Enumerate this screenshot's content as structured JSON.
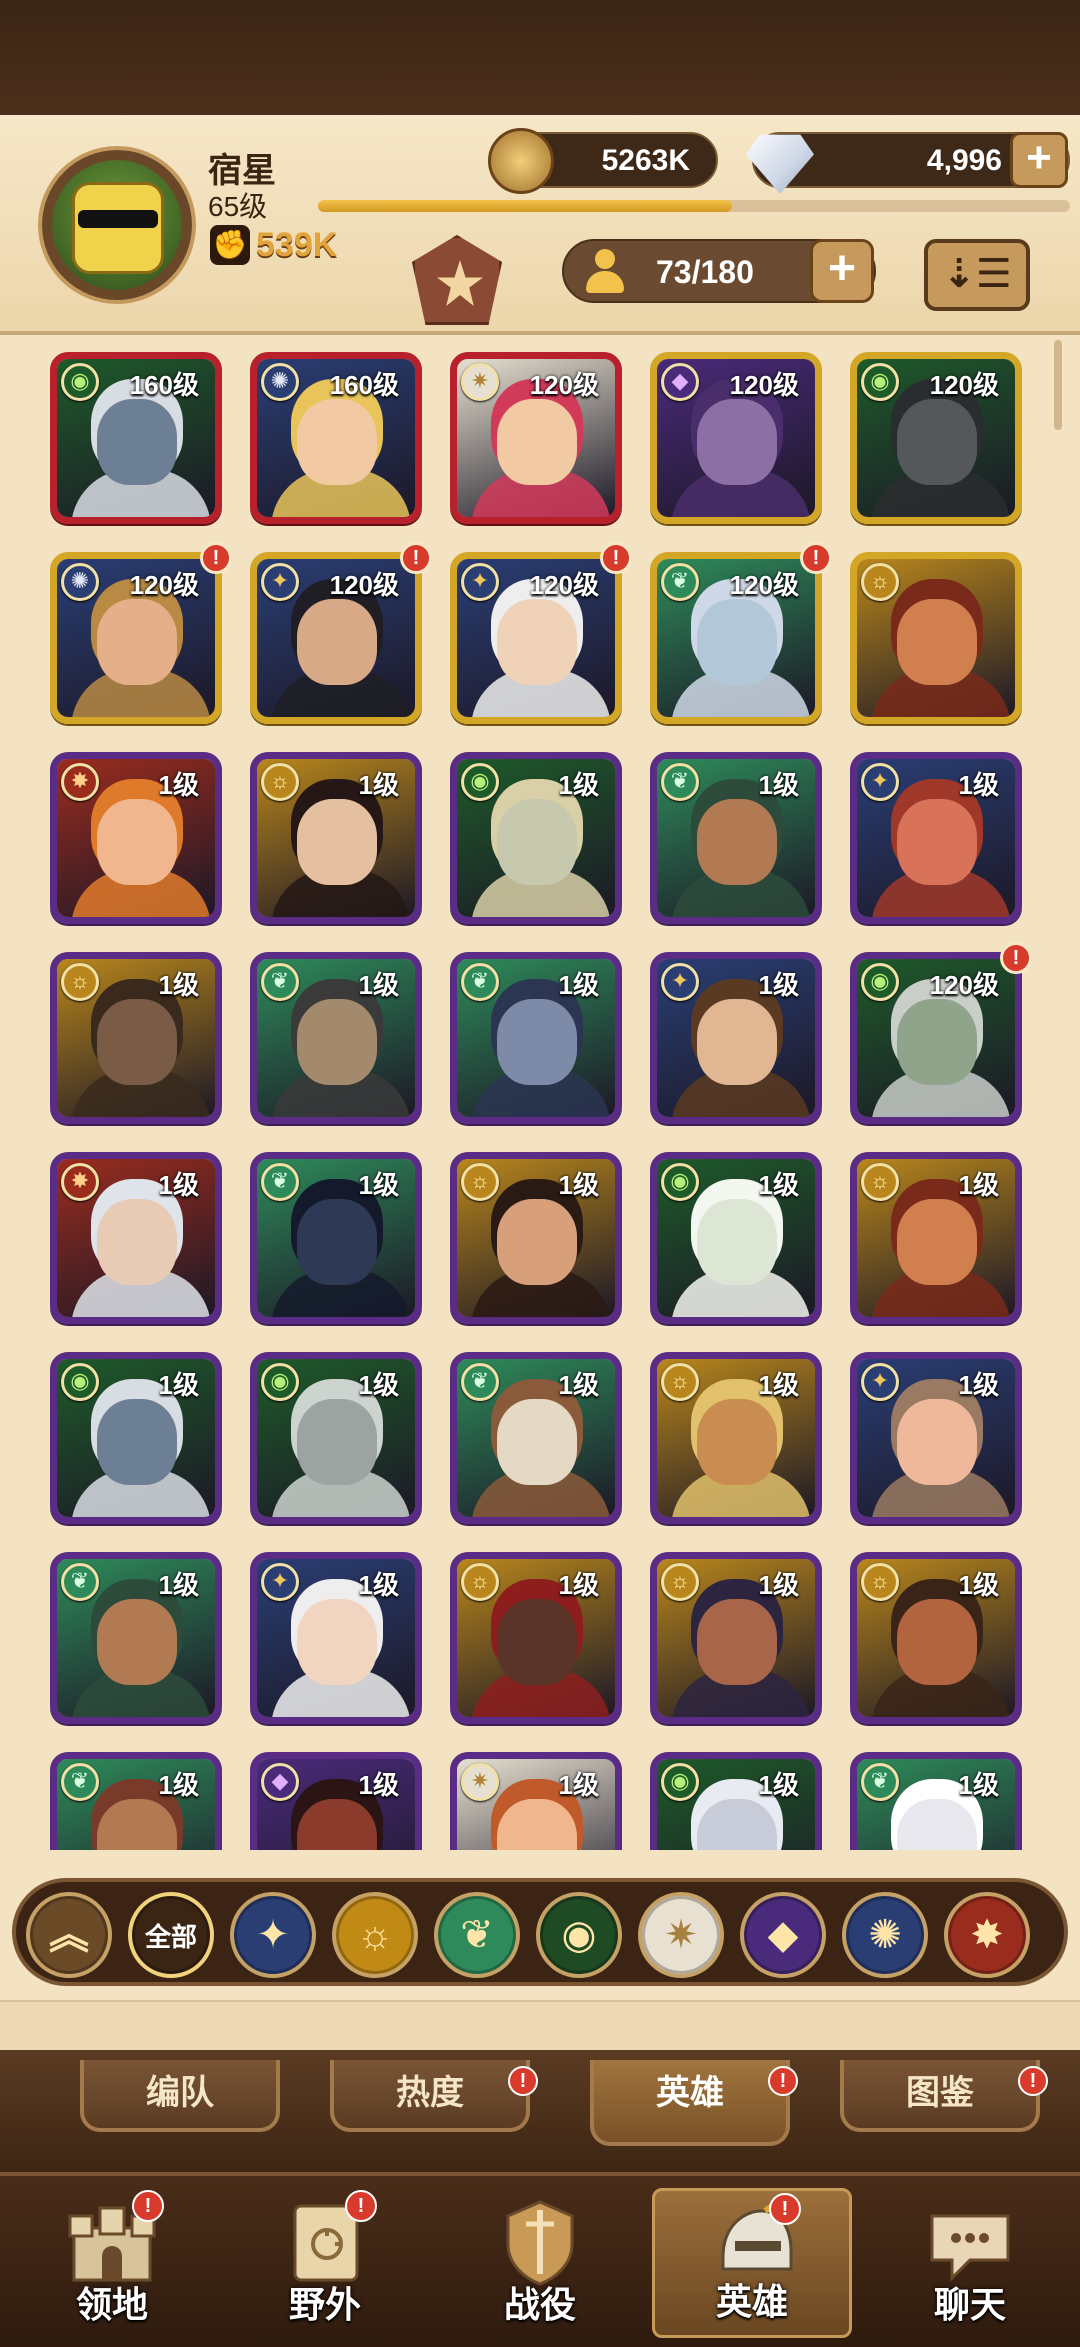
{
  "header": {
    "player_name": "宿星",
    "player_level": "65级",
    "xp_progress": 0.55,
    "power": "539K",
    "gold": "5263K",
    "gems": "4,996",
    "roster": "73/180"
  },
  "colors": {
    "frame_purple": "#5b2c86",
    "frame_gold": "#d4a626",
    "frame_red": "#b8202c",
    "alert_red": "#d83a2c"
  },
  "heroes": [
    {
      "level": "160级",
      "frame": "red",
      "faction": "forest",
      "skin": "#6d7f95",
      "hair": "#d8dde4",
      "alert": false
    },
    {
      "level": "160级",
      "frame": "red",
      "faction": "ring",
      "skin": "#f1c9a3",
      "hair": "#e8c45a",
      "alert": false
    },
    {
      "level": "120级",
      "frame": "red",
      "faction": "light",
      "skin": "#f1c9a3",
      "hair": "#d23a5a",
      "alert": false
    },
    {
      "level": "120级",
      "frame": "gold",
      "faction": "dark",
      "skin": "#8b6fa5",
      "hair": "#4a2e6b",
      "alert": false
    },
    {
      "level": "120级",
      "frame": "gold",
      "faction": "forest",
      "skin": "#55585a",
      "hair": "#2a2d2f",
      "alert": false
    },
    {
      "level": "120级",
      "frame": "gold",
      "faction": "ring",
      "skin": "#e5b089",
      "hair": "#b98a44",
      "alert": true
    },
    {
      "level": "120级",
      "frame": "gold",
      "faction": "star",
      "skin": "#d8a987",
      "hair": "#1e1e24",
      "alert": true
    },
    {
      "level": "120级",
      "frame": "gold",
      "faction": "star",
      "skin": "#efd2b7",
      "hair": "#eeeeee",
      "alert": true
    },
    {
      "level": "120级",
      "frame": "gold",
      "faction": "leaf",
      "skin": "#b2c8d8",
      "hair": "#cfd8e6",
      "alert": true
    },
    {
      "level": "",
      "frame": "gold",
      "faction": "sun",
      "skin": "#d27f4f",
      "hair": "#7a2a1a",
      "alert": false
    },
    {
      "level": "1级",
      "frame": "purple",
      "faction": "fire",
      "skin": "#f0b78e",
      "hair": "#e07a2b",
      "alert": false
    },
    {
      "level": "1级",
      "frame": "purple",
      "faction": "sun",
      "skin": "#e4c0a0",
      "hair": "#241715",
      "alert": false
    },
    {
      "level": "1级",
      "frame": "purple",
      "faction": "forest",
      "skin": "#c7c9ae",
      "hair": "#d9d0a8",
      "alert": false
    },
    {
      "level": "1级",
      "frame": "purple",
      "faction": "leaf",
      "skin": "#b27a52",
      "hair": "#2d4b3b",
      "alert": false
    },
    {
      "level": "1级",
      "frame": "purple",
      "faction": "star",
      "skin": "#d8735a",
      "hair": "#a0382a",
      "alert": false
    },
    {
      "level": "1级",
      "frame": "purple",
      "faction": "sun",
      "skin": "#7a5b45",
      "hair": "#3a2a1e",
      "alert": false
    },
    {
      "level": "1级",
      "frame": "purple",
      "faction": "leaf",
      "skin": "#a38a6c",
      "hair": "#3a3a3a",
      "alert": false
    },
    {
      "level": "1级",
      "frame": "purple",
      "faction": "leaf",
      "skin": "#7d8aa8",
      "hair": "#2c3552",
      "alert": false
    },
    {
      "level": "1级",
      "frame": "purple",
      "faction": "star",
      "skin": "#e1b693",
      "hair": "#5a3a22",
      "alert": false
    },
    {
      "level": "120级",
      "frame": "purple",
      "faction": "forest",
      "skin": "#8fa48a",
      "hair": "#c9cec9",
      "alert": true
    },
    {
      "level": "1级",
      "frame": "purple",
      "faction": "fire",
      "skin": "#e8cbb4",
      "hair": "#dfe3ea",
      "alert": false
    },
    {
      "level": "1级",
      "frame": "purple",
      "faction": "leaf",
      "skin": "#2e3a55",
      "hair": "#141a2b",
      "alert": false
    },
    {
      "level": "1级",
      "frame": "purple",
      "faction": "sun",
      "skin": "#d8a07a",
      "hair": "#2a1a14",
      "alert": false
    },
    {
      "level": "1级",
      "frame": "purple",
      "faction": "forest",
      "skin": "#dde6d4",
      "hair": "#f4f6f0",
      "alert": false
    },
    {
      "level": "1级",
      "frame": "purple",
      "faction": "sun",
      "skin": "#d27f4f",
      "hair": "#7a2a1a",
      "alert": false
    },
    {
      "level": "1级",
      "frame": "purple",
      "faction": "forest",
      "skin": "#6d7f95",
      "hair": "#d8dde4",
      "alert": false
    },
    {
      "level": "1级",
      "frame": "purple",
      "faction": "forest",
      "skin": "#9ca3a1",
      "hair": "#cdd3cf",
      "alert": false
    },
    {
      "level": "1级",
      "frame": "purple",
      "faction": "leaf",
      "skin": "#e5d8c4",
      "hair": "#8a5a3a",
      "alert": false
    },
    {
      "level": "1级",
      "frame": "purple",
      "faction": "sun",
      "skin": "#c98d52",
      "hair": "#e1c16b",
      "alert": false
    },
    {
      "level": "1级",
      "frame": "purple",
      "faction": "star",
      "skin": "#f0b89a",
      "hair": "#9a7a62",
      "alert": false
    },
    {
      "level": "1级",
      "frame": "purple",
      "faction": "leaf",
      "skin": "#b27a52",
      "hair": "#2d4b3b",
      "alert": false
    },
    {
      "level": "1级",
      "frame": "purple",
      "faction": "star",
      "skin": "#f1d5c0",
      "hair": "#eeeeee",
      "alert": false
    },
    {
      "level": "1级",
      "frame": "purple",
      "faction": "sun",
      "skin": "#5a3428",
      "hair": "#8e1e1e",
      "alert": false
    },
    {
      "level": "1级",
      "frame": "purple",
      "faction": "sun",
      "skin": "#a8654a",
      "hair": "#2d2540",
      "alert": false
    },
    {
      "level": "1级",
      "frame": "purple",
      "faction": "sun",
      "skin": "#b2643e",
      "hair": "#3a2418",
      "alert": false
    },
    {
      "level": "1级",
      "frame": "purple",
      "faction": "leaf",
      "skin": "#b27a52",
      "hair": "#7a3a2a",
      "alert": false
    },
    {
      "level": "1级",
      "frame": "purple",
      "faction": "dark",
      "skin": "#8a3b2b",
      "hair": "#2a1414",
      "alert": false
    },
    {
      "level": "1级",
      "frame": "purple",
      "faction": "light",
      "skin": "#f0b78e",
      "hair": "#c05a2a",
      "alert": false
    },
    {
      "level": "1级",
      "frame": "purple",
      "faction": "forest",
      "skin": "#c8ccd8",
      "hair": "#e8ecf2",
      "alert": false
    },
    {
      "level": "1级",
      "frame": "purple",
      "faction": "leaf",
      "skin": "#e8e8ee",
      "hair": "#ffffff",
      "alert": false
    }
  ],
  "factions": {
    "forest": {
      "bg": "#1e5a2a",
      "glyph": "◉",
      "color": "#b7f07a"
    },
    "ring": {
      "bg": "#2a3e74",
      "glyph": "✺",
      "color": "#e6e8f5"
    },
    "light": {
      "bg": "#e7e0d0",
      "glyph": "✷",
      "color": "#b2843a"
    },
    "dark": {
      "bg": "#4a2a7a",
      "glyph": "◆",
      "color": "#e0b0ff"
    },
    "star": {
      "bg": "#2a3e74",
      "glyph": "✦",
      "color": "#f0c860"
    },
    "leaf": {
      "bg": "#2e8a5a",
      "glyph": "❦",
      "color": "#d8ffe0"
    },
    "sun": {
      "bg": "#b8861c",
      "glyph": "☼",
      "color": "#fff0b0"
    },
    "fire": {
      "bg": "#9a2c1e",
      "glyph": "✸",
      "color": "#ffd08a"
    }
  },
  "filter_bar": {
    "all_label": "全部",
    "buttons": [
      {
        "name": "filter-collapse-button",
        "glyph": "︽",
        "bg": "#6b4a28"
      },
      {
        "name": "filter-all-button",
        "glyph": "",
        "bg": "#3a2414"
      },
      {
        "name": "filter-star-button",
        "glyph": "✦",
        "bg": "#2a3e74"
      },
      {
        "name": "filter-sun-button",
        "glyph": "☼",
        "bg": "#c18a14"
      },
      {
        "name": "filter-leaf-button",
        "glyph": "❦",
        "bg": "#2e8a5a"
      },
      {
        "name": "filter-forest-button",
        "glyph": "◉",
        "bg": "#1e4a24"
      },
      {
        "name": "filter-light-button",
        "glyph": "✷",
        "bg": "#e8e0d0"
      },
      {
        "name": "filter-dark-button",
        "glyph": "◆",
        "bg": "#4a2a7a"
      },
      {
        "name": "filter-ring-button",
        "glyph": "✺",
        "bg": "#2a3e74"
      },
      {
        "name": "filter-fire-button",
        "glyph": "✸",
        "bg": "#9a2c1e"
      }
    ]
  },
  "subtabs": [
    {
      "label": "编队",
      "alert": false,
      "active": false
    },
    {
      "label": "热度",
      "alert": true,
      "active": false
    },
    {
      "label": "英雄",
      "alert": true,
      "active": true
    },
    {
      "label": "图鉴",
      "alert": true,
      "active": false
    }
  ],
  "bottom_nav": [
    {
      "label": "领地",
      "alert": true,
      "active": false,
      "icon": "castle-icon"
    },
    {
      "label": "野外",
      "alert": true,
      "active": false,
      "icon": "map-scroll-icon"
    },
    {
      "label": "战役",
      "alert": false,
      "active": false,
      "icon": "sword-shield-icon"
    },
    {
      "label": "英雄",
      "alert": true,
      "active": true,
      "icon": "helmet-icon"
    },
    {
      "label": "聊天",
      "alert": false,
      "active": false,
      "icon": "chat-bubble-icon"
    }
  ],
  "alert_mark": "!"
}
